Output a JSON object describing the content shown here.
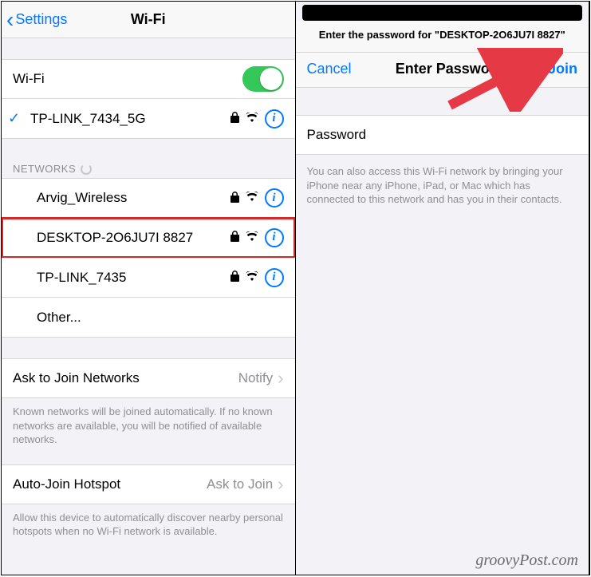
{
  "left": {
    "back_label": "Settings",
    "title": "Wi-Fi",
    "wifi_toggle_label": "Wi-Fi",
    "connected_network": "TP-LINK_7434_5G",
    "networks_header": "NETWORKS",
    "networks": [
      {
        "name": "Arvig_Wireless"
      },
      {
        "name": "DESKTOP-2O6JU7I 8827"
      },
      {
        "name": "TP-LINK_7435"
      }
    ],
    "other_label": "Other...",
    "ask_join_label": "Ask to Join Networks",
    "ask_join_value": "Notify",
    "ask_join_footer": "Known networks will be joined automatically. If no known networks are available, you will be notified of available networks.",
    "auto_join_label": "Auto-Join Hotspot",
    "auto_join_value": "Ask to Join",
    "auto_join_footer": "Allow this device to automatically discover nearby personal hotspots when no Wi-Fi network is available."
  },
  "right": {
    "prompt": "Enter the password for \"DESKTOP-2O6JU7I 8827\"",
    "cancel": "Cancel",
    "title": "Enter Password",
    "join": "Join",
    "password_label": "Password",
    "password_placeholder": "",
    "help_text": "You can also access this Wi-Fi network by bringing your iPhone near any iPhone, iPad, or Mac which has connected to this network and has you in their contacts."
  },
  "watermark": "groovyPost.com"
}
